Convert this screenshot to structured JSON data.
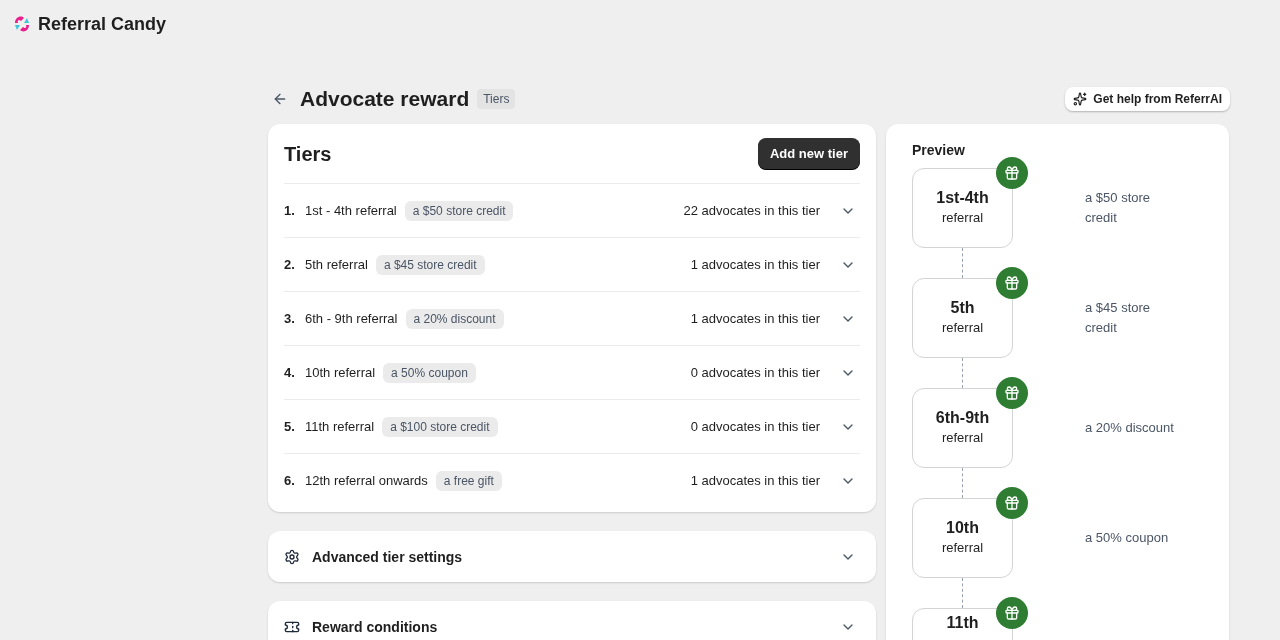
{
  "brand": {
    "name": "Referral Candy"
  },
  "header": {
    "title": "Advocate reward",
    "badge": "Tiers",
    "help_button": "Get help from ReferrAI"
  },
  "tiers_card": {
    "title": "Tiers",
    "add_button": "Add new tier",
    "rows": [
      {
        "number": "1.",
        "label": "1st - 4th referral",
        "reward": "a $50 store credit",
        "count": "22 advocates in this tier",
        "expanded": false
      },
      {
        "number": "2.",
        "label": "5th referral",
        "reward": "a $45 store credit",
        "count": "1 advocates in this tier",
        "expanded": false
      },
      {
        "number": "3.",
        "label": "6th - 9th referral",
        "reward": "a 20% discount",
        "count": "1 advocates in this tier",
        "expanded": false
      },
      {
        "number": "4.",
        "label": "10th referral",
        "reward": "a 50% coupon",
        "count": "0 advocates in this tier",
        "expanded": false
      },
      {
        "number": "5.",
        "label": "11th referral",
        "reward": "a $100 store credit",
        "count": "0 advocates in this tier",
        "expanded": false
      },
      {
        "number": "6.",
        "label": "12th referral onwards",
        "reward": "a free gift",
        "count": "1 advocates in this tier",
        "expanded": false
      }
    ]
  },
  "sections": [
    {
      "kind": "settings",
      "title": "Advanced tier settings",
      "expanded": false
    },
    {
      "kind": "conditions",
      "title": "Reward conditions",
      "expanded": false
    }
  ],
  "preview": {
    "title": "Preview",
    "steps": [
      {
        "title": "1st-4th",
        "subtitle": "referral",
        "reward": "a $50 store credit"
      },
      {
        "title": "5th",
        "subtitle": "referral",
        "reward": "a $45 store credit"
      },
      {
        "title": "6th-9th",
        "subtitle": "referral",
        "reward": "a 20% discount"
      },
      {
        "title": "10th",
        "subtitle": "referral",
        "reward": "a 50% coupon"
      },
      {
        "title": "11th"
      }
    ]
  }
}
